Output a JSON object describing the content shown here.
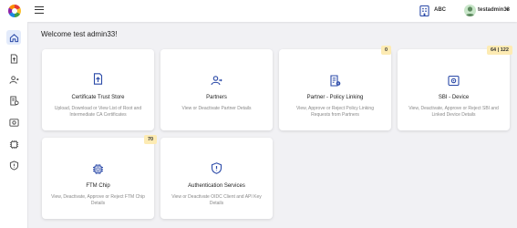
{
  "header": {
    "org_label": "ABC",
    "user_name": "testadmin33",
    "caret": "▼"
  },
  "sidebar": {
    "items": [
      {
        "name": "home-icon",
        "active": true
      },
      {
        "name": "certificate-icon",
        "active": false
      },
      {
        "name": "partners-icon",
        "active": false
      },
      {
        "name": "policy-icon",
        "active": false
      },
      {
        "name": "device-icon",
        "active": false
      },
      {
        "name": "chip-icon",
        "active": false
      },
      {
        "name": "shield-icon",
        "active": false
      }
    ]
  },
  "main": {
    "welcome": "Welcome test admin33!",
    "cards": [
      {
        "title": "Certificate Trust Store",
        "description": "Upload, Download or View List of Root and Intermediate CA Certificates",
        "icon": "certificate-upload-icon",
        "badge": ""
      },
      {
        "title": "Partners",
        "description": "View or Deactivate Partner Details",
        "icon": "partners-icon",
        "badge": ""
      },
      {
        "title": "Partner - Policy Linking",
        "description": "View, Approve or Reject Policy Linking Requests from Partners",
        "icon": "policy-linking-icon",
        "badge": "0"
      },
      {
        "title": "SBI - Device",
        "description": "View, Deactivate, Approve or Reject SBI and Linked Device Details",
        "icon": "device-icon",
        "badge": "64 | 122"
      },
      {
        "title": "FTM Chip",
        "description": "View, Deactivate, Approve or Reject FTM Chip Details",
        "icon": "chip-icon",
        "badge": "70"
      },
      {
        "title": "Authentication Services",
        "description": "View or Deactivate OIDC Client and API Key Details",
        "icon": "shield-icon",
        "badge": ""
      }
    ]
  },
  "colors": {
    "accent": "#2b4aa8",
    "badge_bg": "#fdebb3",
    "background": "#f1f1f4"
  }
}
